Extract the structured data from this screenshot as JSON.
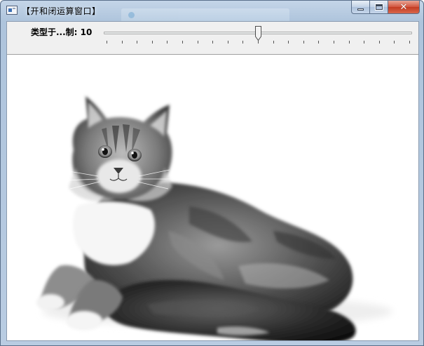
{
  "window": {
    "title": "【开和闭运算窗口】",
    "close_glyph": "✕"
  },
  "trackbar": {
    "label": "类型于...制: 10",
    "value": 10,
    "min": 0,
    "max": 20,
    "fill_fraction": 0.5
  },
  "icons": {
    "app": "window-app-icon",
    "minimize": "minimize-icon",
    "maximize": "maximize-icon",
    "close": "close-icon"
  },
  "image": {
    "subject": "cat"
  },
  "colors": {
    "titlebar": "#c4d5e8",
    "close_button": "#c33b22",
    "toolbar_bg": "#f0f0f0"
  }
}
